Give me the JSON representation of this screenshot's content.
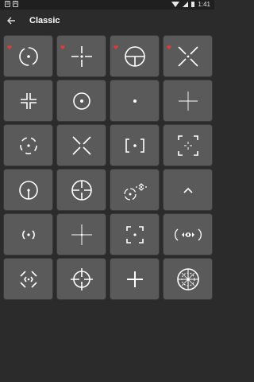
{
  "status_bar": {
    "time": "1:41"
  },
  "toolbar": {
    "title": "Classic"
  },
  "icons": {
    "back": "arrow-left-icon",
    "favorite": "heart-icon",
    "wifi": "wifi-icon",
    "signal": "signal-icon",
    "battery": "battery-icon"
  },
  "colors": {
    "favorite": "#e53935",
    "tile": "#5a5a5a",
    "background": "#2b2b2b"
  },
  "crosshairs": [
    {
      "id": "dot-ring-gaps",
      "favorite": true
    },
    {
      "id": "cross-gap-dot",
      "favorite": true
    },
    {
      "id": "scope-circle-t",
      "favorite": true
    },
    {
      "id": "x-cross-dot",
      "favorite": true
    },
    {
      "id": "corner-brackets-small",
      "favorite": false
    },
    {
      "id": "circle-dot",
      "favorite": false
    },
    {
      "id": "dot",
      "favorite": false
    },
    {
      "id": "thin-cross",
      "favorite": false
    },
    {
      "id": "dashed-circle-dot",
      "favorite": false
    },
    {
      "id": "x-cross",
      "favorite": false
    },
    {
      "id": "square-brackets-dot",
      "favorite": false
    },
    {
      "id": "corner-frame-cross",
      "favorite": false
    },
    {
      "id": "circle-tick-dot",
      "favorite": false
    },
    {
      "id": "circle-cross-scope",
      "favorite": false
    },
    {
      "id": "circle-tick-diamond",
      "favorite": false
    },
    {
      "id": "chevron-up",
      "favorite": false
    },
    {
      "id": "parentheses-dot",
      "favorite": false
    },
    {
      "id": "thin-cross-dot",
      "favorite": false
    },
    {
      "id": "corner-frame-dot",
      "favorite": false
    },
    {
      "id": "arrows-circle",
      "favorite": false
    },
    {
      "id": "broken-diamond-dot",
      "favorite": false
    },
    {
      "id": "circle-cross-long",
      "favorite": false
    },
    {
      "id": "plus-bold",
      "favorite": false
    },
    {
      "id": "mil-dot-scope",
      "favorite": false
    }
  ]
}
